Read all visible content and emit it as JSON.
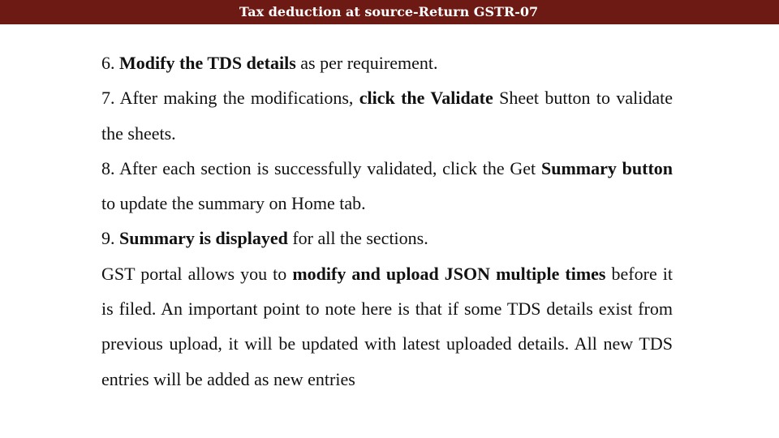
{
  "header": {
    "title": "Tax deduction at source-Return GSTR-07",
    "background_color": "#6e1a14",
    "text_color": "#ffffff"
  },
  "steps": [
    {
      "number": "6.",
      "parts": [
        {
          "text": "Modify the TDS details",
          "bold": true
        },
        {
          "text": " as per requirement.",
          "bold": false
        }
      ]
    },
    {
      "number": "7.",
      "parts": [
        {
          "text": " After making the modifications, ",
          "bold": false
        },
        {
          "text": "click the Validate",
          "bold": true
        },
        {
          "text": " Sheet button to validate the sheets.",
          "bold": false
        }
      ]
    },
    {
      "number": "8.",
      "parts": [
        {
          "text": " After each section is successfully validated, click the Get ",
          "bold": false
        },
        {
          "text": "Summary button",
          "bold": true
        },
        {
          "text": " to update the summary on Home tab.",
          "bold": false
        }
      ]
    },
    {
      "number": "9.",
      "parts": [
        {
          "text": "Summary is displayed",
          "bold": true
        },
        {
          "text": " for all the sections.",
          "bold": false
        }
      ]
    }
  ],
  "note": {
    "parts": [
      {
        "text": "GST portal allows you to ",
        "bold": false
      },
      {
        "text": "modify and upload JSON multiple times",
        "bold": true
      },
      {
        "text": " before it is filed. An important point to note here is that if some TDS details exist from previous upload, it will be updated with latest uploaded details. All new TDS entries will be added as new entries",
        "bold": false
      }
    ]
  }
}
